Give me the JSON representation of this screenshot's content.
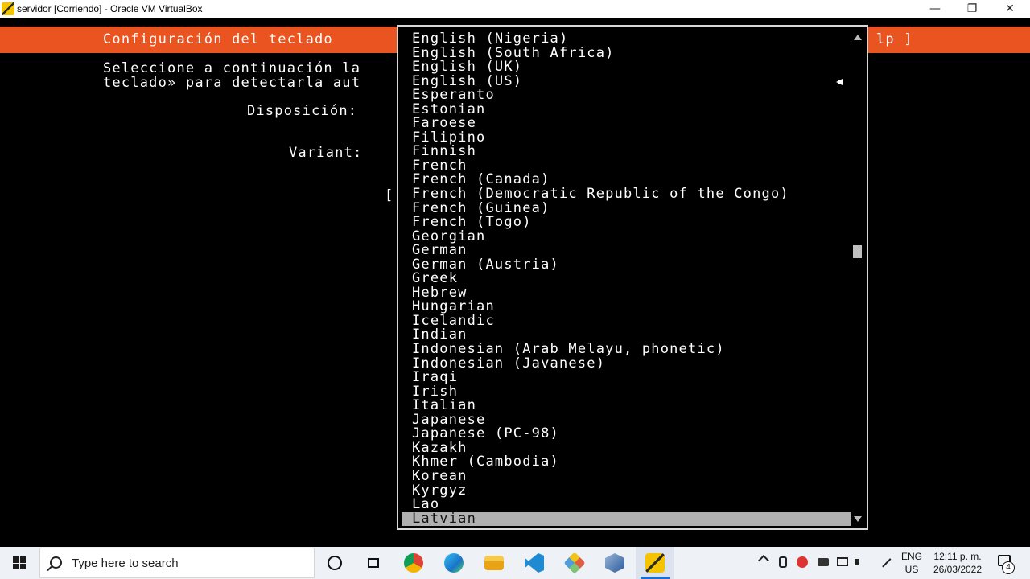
{
  "window": {
    "title": "servidor [Corriendo] - Oracle VM VirtualBox",
    "minimize": "—",
    "restore": "❐",
    "close": "✕"
  },
  "installer": {
    "header_title": "Configuración del teclado",
    "help_tail": "lp ]",
    "description_line1": "Seleccione a continuación la",
    "description_line2": "teclado» para detectarla aut",
    "layout_label": "Disposición:",
    "variant_label": "Variant:",
    "bracket": "["
  },
  "dropdown": {
    "items": [
      "English (Nigeria)",
      "English (South Africa)",
      "English (UK)",
      "English (US)",
      "Esperanto",
      "Estonian",
      "Faroese",
      "Filipino",
      "Finnish",
      "French",
      "French (Canada)",
      "French (Democratic Republic of the Congo)",
      "French (Guinea)",
      "French (Togo)",
      "Georgian",
      "German",
      "German (Austria)",
      "Greek",
      "Hebrew",
      "Hungarian",
      "Icelandic",
      "Indian",
      "Indonesian (Arab Melayu, phonetic)",
      "Indonesian (Javanese)",
      "Iraqi",
      "Irish",
      "Italian",
      "Japanese",
      "Japanese (PC-98)",
      "Kazakh",
      "Khmer (Cambodia)",
      "Korean",
      "Kyrgyz",
      "Lao",
      "Latvian"
    ],
    "selected": "Latvian",
    "current": "English (US)"
  },
  "taskbar": {
    "search_placeholder": "Type here to search",
    "apps": [
      "chrome-icon",
      "edge-icon",
      "file-explorer-icon",
      "vscode-icon",
      "git-icon",
      "virtualbox-icon",
      "vm-window-icon"
    ],
    "lang_line1": "ENG",
    "lang_line2": "US",
    "time": "12:11 p. m.",
    "date": "26/03/2022",
    "notification_count": "4"
  }
}
